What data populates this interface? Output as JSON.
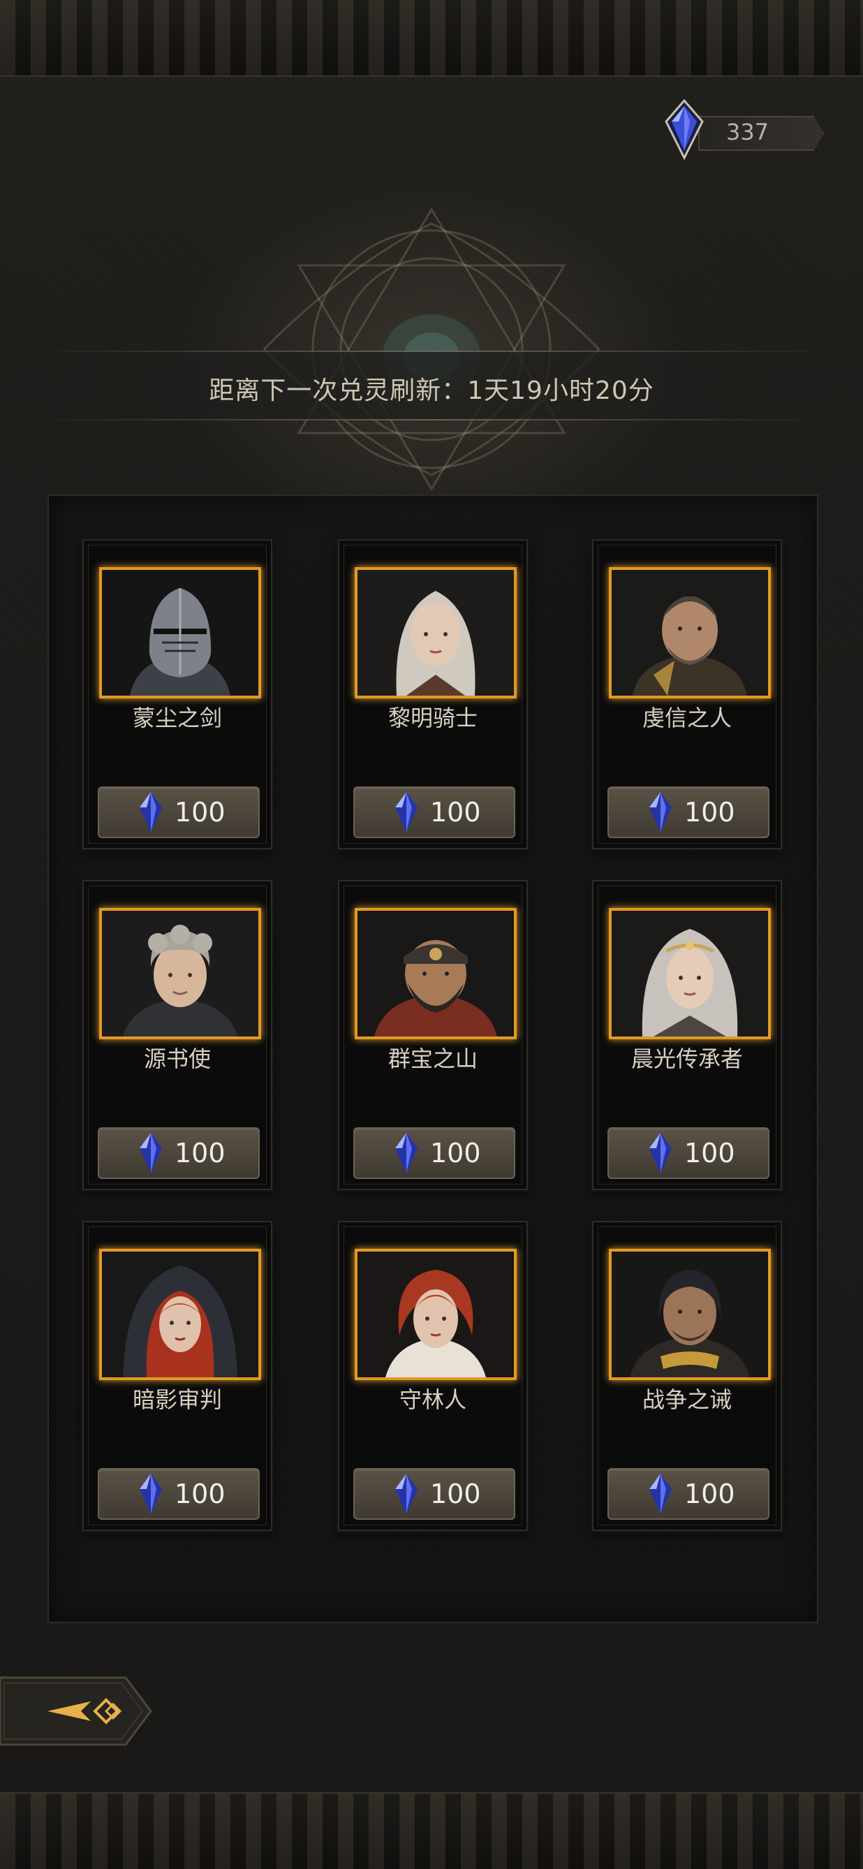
{
  "currency": {
    "icon": "blue-crystal-icon",
    "amount": "337"
  },
  "refresh": {
    "text": "距离下一次兑灵刷新：1天19小时20分"
  },
  "heroes": [
    {
      "name": "蒙尘之剑",
      "price": "100",
      "portrait": "armored-knight-helmet"
    },
    {
      "name": "黎明骑士",
      "price": "100",
      "portrait": "silver-haired-woman"
    },
    {
      "name": "虔信之人",
      "price": "100",
      "portrait": "bearded-man"
    },
    {
      "name": "源书使",
      "price": "100",
      "portrait": "curly-haired-youth"
    },
    {
      "name": "群宝之山",
      "price": "100",
      "portrait": "bandana-bearded-man"
    },
    {
      "name": "晨光传承者",
      "price": "100",
      "portrait": "silver-haired-girl-with-circlet"
    },
    {
      "name": "暗影审判",
      "price": "100",
      "portrait": "red-haired-hooded-woman"
    },
    {
      "name": "守林人",
      "price": "100",
      "portrait": "red-haired-woman"
    },
    {
      "name": "战争之诫",
      "price": "100",
      "portrait": "dark-haired-warrior"
    }
  ],
  "colors": {
    "frame_gold": "#e39a22",
    "crystal_blue": "#3c4fd8",
    "background": "#1a1917"
  },
  "back_button": {
    "icon": "back-arrow-icon"
  }
}
